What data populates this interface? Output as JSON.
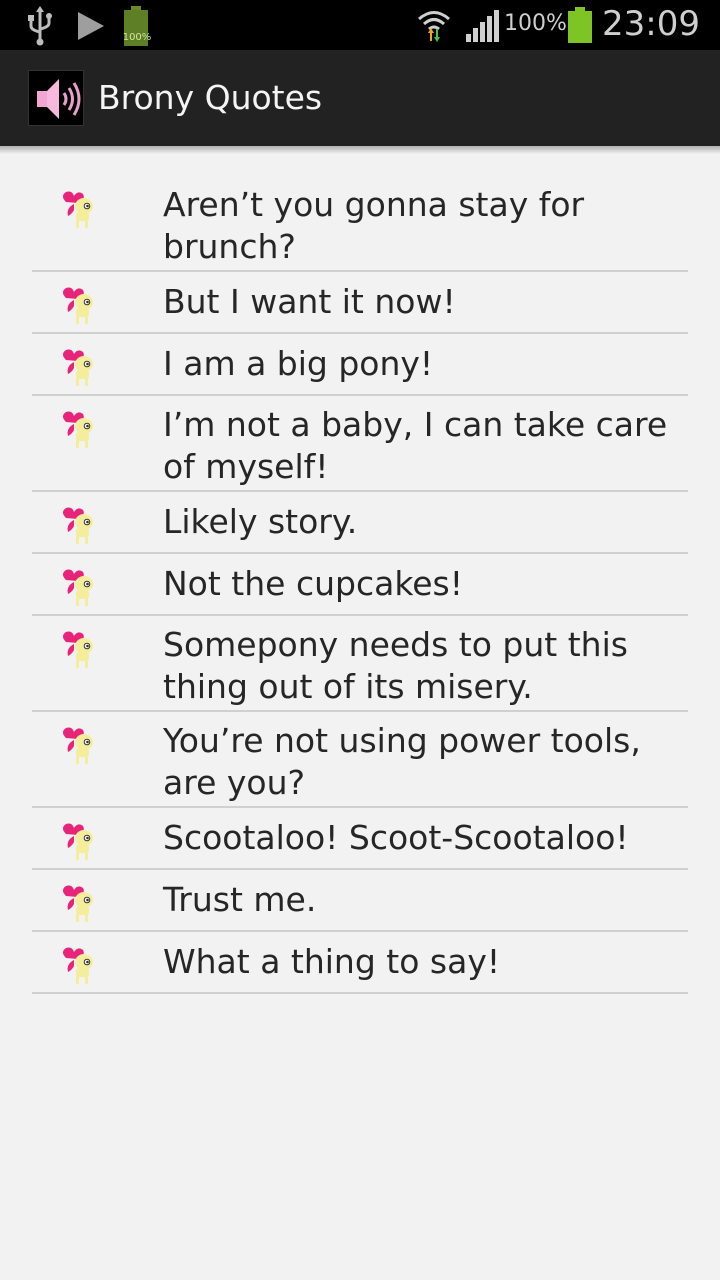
{
  "status_bar": {
    "battery_small_label": "100%",
    "battery_percent": "100%",
    "time": "23:09",
    "icons": [
      "usb-icon",
      "play-store-icon",
      "battery-small-icon",
      "wifi-icon",
      "signal-icon",
      "battery-icon"
    ]
  },
  "action_bar": {
    "title": "Brony Quotes",
    "icon": "speaker-icon"
  },
  "quotes": [
    "Aren’t you gonna stay for brunch?",
    "But I want it now!",
    "I am a big pony!",
    "I’m not a baby, I can take care of myself!",
    "Likely story.",
    "Not the cupcakes!",
    "Somepony needs to put this thing out of its misery.",
    "You’re not using power tools, are you?",
    "Scootaloo! Scoot-Scootaloo!",
    "Trust me.",
    "What a thing to say!"
  ],
  "colors": {
    "status_bg": "#000000",
    "action_bar_bg": "#222222",
    "list_bg": "#f2f2f2",
    "divider": "#d0d0d0",
    "accent_pink": "#e8237a",
    "battery_green": "#7ec424"
  }
}
